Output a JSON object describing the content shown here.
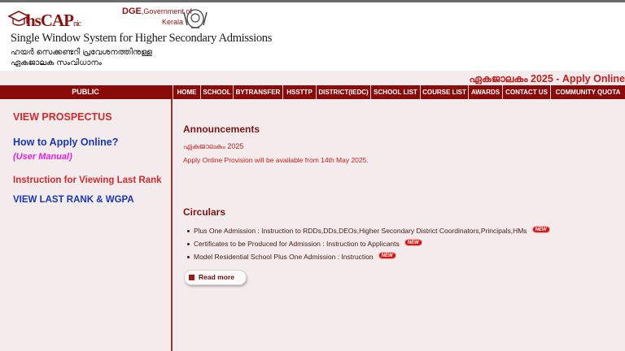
{
  "header": {
    "logo_text": "hsCAP",
    "logo_suffix": "nic",
    "site_title": "Single Window System for Higher Secondary Admissions",
    "malayalam_line1": "ഹയർ സെക്കണ്ടറി പ്രവേശനത്തിനുള്ള",
    "malayalam_line2": "ഏകജാലക സംവിധാനം",
    "dge_short": "DGE",
    "govt_label": ",Government of",
    "state_label": "Kerala"
  },
  "banner": {
    "apply_text": "ഏകജാലകം 2025 - Apply Online"
  },
  "nav": {
    "public_label": "PUBLIC",
    "items": [
      {
        "label": "HOME"
      },
      {
        "label": "SCHOOL"
      },
      {
        "label": "BYTRANSFER"
      },
      {
        "label": "HSSTTP"
      },
      {
        "label": "DISTRICT(IEDC)"
      },
      {
        "label": "SCHOOL LIST"
      },
      {
        "label": "COURSE LIST"
      },
      {
        "label": "AWARDS"
      },
      {
        "label": "CONTACT US"
      },
      {
        "label": "COMMUNITY QUOTA"
      }
    ]
  },
  "sidebar": {
    "prospectus": "VIEW PROSPECTUS",
    "how_to_apply": "How to Apply Online?",
    "user_manual": "(User Manual)",
    "instruction_last_rank": "Instruction for Viewing Last Rank",
    "view_last_rank": "VIEW LAST RANK & WGPA"
  },
  "main": {
    "announcements_heading": "Announcements",
    "announcement_title": "ഏകജാലകം 2025",
    "announcement_text": "Apply Online Provision will be available from 14th May 2025.",
    "circulars_heading": "Circulars",
    "circulars": [
      {
        "text": "Plus One Admission : Instruction to RDDs,DDs,DEOs,Higher Secondary District Coordinators,Principals,HMs",
        "badge": "NEW"
      },
      {
        "text": "Certificates to be Produced for Admission : Instruction to Applicants",
        "badge": "NEW"
      },
      {
        "text": "Model Residential School Plus One Admission : Instruction",
        "badge": "NEW"
      }
    ],
    "read_more": "Read more"
  },
  "colors": {
    "nav_bg": "#8a0a0a",
    "page_bg": "#f4ecec",
    "heading": "#7a1515",
    "link_red": "#d12a2a",
    "link_blue": "#1736b8",
    "manual_magenta": "#e020d8"
  },
  "icons": {
    "logo": "graduation-cap-icon",
    "emblem": "kerala-emblem-icon",
    "bullet": "bullet-dot-icon",
    "read_more": "square-bullet-icon"
  }
}
